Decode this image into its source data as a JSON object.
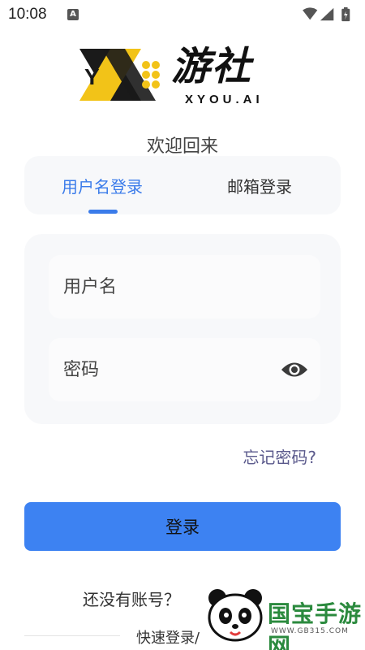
{
  "status_bar": {
    "time": "10:08",
    "notification_icon": "A",
    "icons": [
      "wifi-icon",
      "signal-icon",
      "battery-icon"
    ]
  },
  "logo": {
    "title": "游社",
    "subtitle": "XYOU.AI",
    "colors": {
      "accent": "#f2c318",
      "dark": "#1a1a1a"
    }
  },
  "welcome_text": "欢迎回来",
  "tabs": [
    {
      "label": "用户名登录",
      "active": true
    },
    {
      "label": "邮箱登录",
      "active": false
    }
  ],
  "form": {
    "username_placeholder": "用户名",
    "password_placeholder": "密码",
    "password_toggle_icon": "eye-icon"
  },
  "forgot_password": "忘记密码?",
  "login_button": "登录",
  "register_prompt": "还没有账号？",
  "quick_login": "快速登录/",
  "watermark": {
    "text": "国宝手游网",
    "url": "WWW.GB315.COM"
  },
  "colors": {
    "primary": "#3d82f2",
    "tab_active": "#3a7bea",
    "link": "#5b5a8c"
  }
}
